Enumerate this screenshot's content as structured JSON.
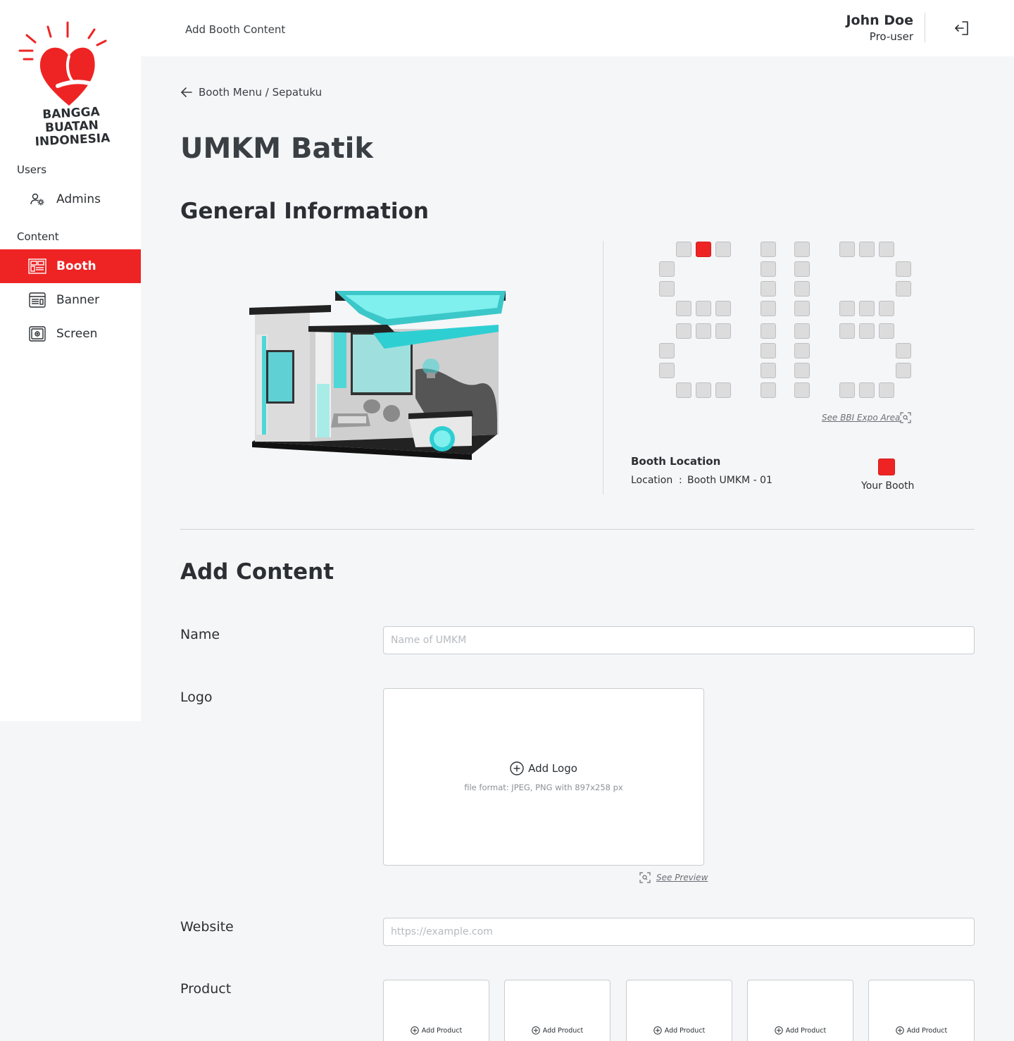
{
  "brand": {
    "line1": "BANGGA BUATAN",
    "line2": "INDONESIA",
    "accent_color": "#ee2424"
  },
  "sidebar": {
    "groups": [
      {
        "label": "Users",
        "items": [
          {
            "label": "Admins",
            "icon": "admin-settings-icon"
          }
        ]
      },
      {
        "label": "Content",
        "items": [
          {
            "label": "Booth",
            "icon": "booth-icon",
            "active": true
          },
          {
            "label": "Banner",
            "icon": "banner-icon"
          },
          {
            "label": "Screen",
            "icon": "screen-icon"
          }
        ]
      }
    ]
  },
  "header": {
    "title": "Add Booth Content",
    "user_name": "John Doe",
    "user_role": "Pro-user",
    "logout_icon": "logout-icon"
  },
  "breadcrumb": "Booth Menu / Sepatuku",
  "page_title": "UMKM Batik",
  "general": {
    "title": "General Information",
    "expo_link": "See BBI Expo Area",
    "location_title": "Booth Location",
    "location_label": "Location",
    "location_sep": ":",
    "location_value": "Booth UMKM - 01",
    "legend_label": "Your Booth"
  },
  "add_content": {
    "title": "Add Content",
    "name_label": "Name",
    "name_placeholder": "Name of UMKM",
    "logo_label": "Logo",
    "logo_add": "Add Logo",
    "logo_hint": "file format: JPEG, PNG with 897x258 px",
    "see_preview": "See Preview",
    "website_label": "Website",
    "website_placeholder": "https://example.com",
    "product_label": "Product",
    "products": [
      {
        "label": "Add Product"
      },
      {
        "label": "Add Product"
      },
      {
        "label": "Add Product"
      },
      {
        "label": "Add Product"
      },
      {
        "label": "Add Product"
      }
    ]
  }
}
